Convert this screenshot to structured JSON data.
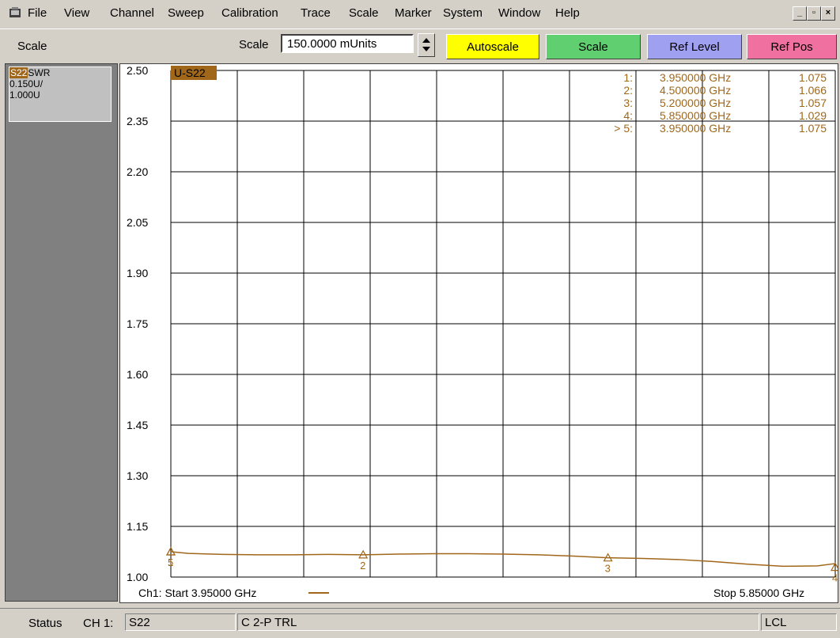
{
  "menu": {
    "items": [
      "File",
      "View",
      "Channel",
      "Sweep",
      "Calibration",
      "Trace",
      "Scale",
      "Marker",
      "System",
      "Window",
      "Help"
    ]
  },
  "toolbar": {
    "title": "Scale",
    "scale_label": "Scale",
    "scale_value": "150.0000 mUnits",
    "autoscale_label": "Autoscale",
    "scale_button_label": "Scale",
    "ref_level_label": "Ref Level",
    "ref_pos_label": "Ref Pos",
    "colors": {
      "autoscale": "#ffff00",
      "scale": "#5fcf6f",
      "ref_level": "#a0a0f0",
      "ref_pos": "#f070a0"
    }
  },
  "trace_info": {
    "param": "S22",
    "format": "SWR",
    "per_div": "0.150U/",
    "ref": "1.000U"
  },
  "chart": {
    "trace_label": "U-S22",
    "start_label": "Ch1: Start  3.95000 GHz",
    "stop_label": "Stop  5.85000 GHz",
    "markers": [
      {
        "id": "1:",
        "freq": "3.950000 GHz",
        "value": "1.075"
      },
      {
        "id": "2:",
        "freq": "4.500000 GHz",
        "value": "1.066"
      },
      {
        "id": "3:",
        "freq": "5.200000 GHz",
        "value": "1.057"
      },
      {
        "id": "4:",
        "freq": "5.850000 GHz",
        "value": "1.029"
      },
      {
        "id": "> 5:",
        "freq": "3.950000 GHz",
        "value": "1.075"
      }
    ],
    "trace_color": "#a0671a"
  },
  "chart_data": {
    "type": "line",
    "ylim": [
      1.0,
      2.5
    ],
    "xlim": [
      3.95,
      5.85
    ],
    "yticks": [
      "2.50",
      "2.35",
      "2.20",
      "2.05",
      "1.90",
      "1.75",
      "1.60",
      "1.45",
      "1.30",
      "1.15",
      "1.00"
    ],
    "series": [
      {
        "name": "S22",
        "x": [
          3.95,
          4.0,
          4.1,
          4.2,
          4.3,
          4.4,
          4.5,
          4.6,
          4.7,
          4.8,
          4.9,
          5.0,
          5.1,
          5.2,
          5.3,
          5.4,
          5.5,
          5.6,
          5.7,
          5.8,
          5.85
        ],
        "y": [
          1.075,
          1.07,
          1.067,
          1.066,
          1.066,
          1.067,
          1.066,
          1.068,
          1.069,
          1.069,
          1.068,
          1.066,
          1.062,
          1.057,
          1.055,
          1.052,
          1.046,
          1.038,
          1.032,
          1.033,
          1.04
        ]
      }
    ],
    "markers": [
      {
        "label": "1",
        "x": 3.95,
        "y": 1.075
      },
      {
        "label": "2",
        "x": 4.5,
        "y": 1.066
      },
      {
        "label": "3",
        "x": 5.2,
        "y": 1.057
      },
      {
        "label": "4",
        "x": 5.85,
        "y": 1.029
      },
      {
        "label": "5",
        "x": 3.95,
        "y": 1.075
      }
    ]
  },
  "status": {
    "label": "Status",
    "channel": "CH 1:",
    "param": "S22",
    "cal": "C  2-P TRL",
    "remote": "LCL"
  }
}
